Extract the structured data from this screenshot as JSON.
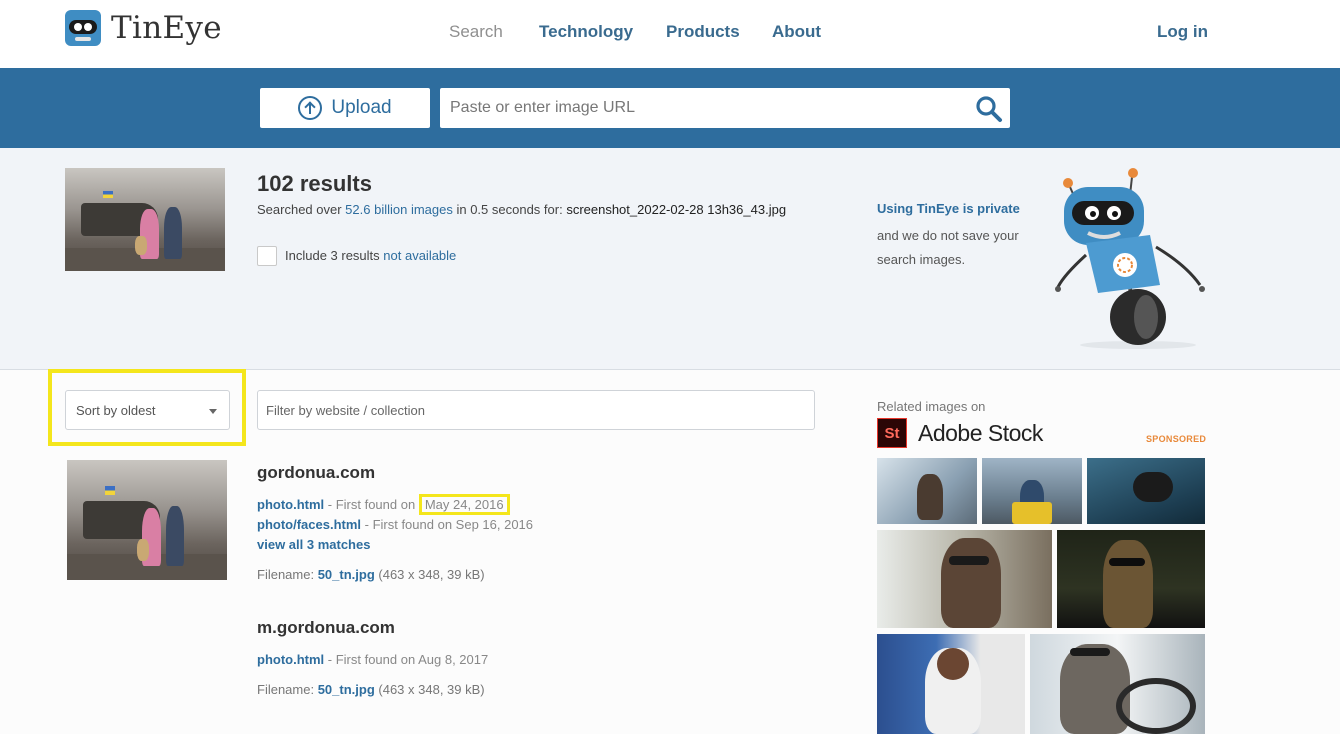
{
  "header": {
    "brand": "TinEye",
    "nav": {
      "search": "Search",
      "technology": "Technology",
      "products": "Products",
      "about": "About",
      "login": "Log in"
    }
  },
  "search": {
    "upload_label": "Upload",
    "url_placeholder": "Paste or enter image URL"
  },
  "summary": {
    "results_count": "102 results",
    "searched_prefix": "Searched over ",
    "searched_link": "52.6 billion images",
    "searched_middle": " in 0.5 seconds for: ",
    "query_file": "screenshot_2022-02-28 13h36_43.jpg",
    "include_prefix": "Include 3 results ",
    "include_link": "not available",
    "private_link": "Using TinEye is private",
    "private_text": "and we do not save your search images."
  },
  "filters": {
    "sort_value": "Sort by oldest",
    "filter_placeholder": "Filter by website / collection"
  },
  "results": [
    {
      "site": "gordonua.com",
      "matches": [
        {
          "page": "photo.html",
          "sep": " - First found on ",
          "date": "May 24, 2016"
        },
        {
          "page": "photo/faces.html",
          "sep": " - First found on ",
          "date": "Sep 16, 2016"
        }
      ],
      "view_all": "view all 3 matches",
      "filename_label": "Filename: ",
      "filename": "50_tn.jpg",
      "filename_meta": " (463 x 348, 39 kB)"
    },
    {
      "site": "m.gordonua.com",
      "matches": [
        {
          "page": "photo.html",
          "sep": " - First found on ",
          "date": "Aug 8, 2017"
        }
      ],
      "filename_label": "Filename: ",
      "filename": "50_tn.jpg",
      "filename_meta": " (463 x 348, 39 kB)"
    }
  ],
  "sidebar": {
    "related_label": "Related images on",
    "stock_logo": "St",
    "stock_name": "Adobe Stock",
    "sponsored": "SPONSORED"
  },
  "colors": {
    "accent": "#2e6d9e",
    "highlight": "#f4e61c",
    "brand_band": "#2e6d9e"
  }
}
